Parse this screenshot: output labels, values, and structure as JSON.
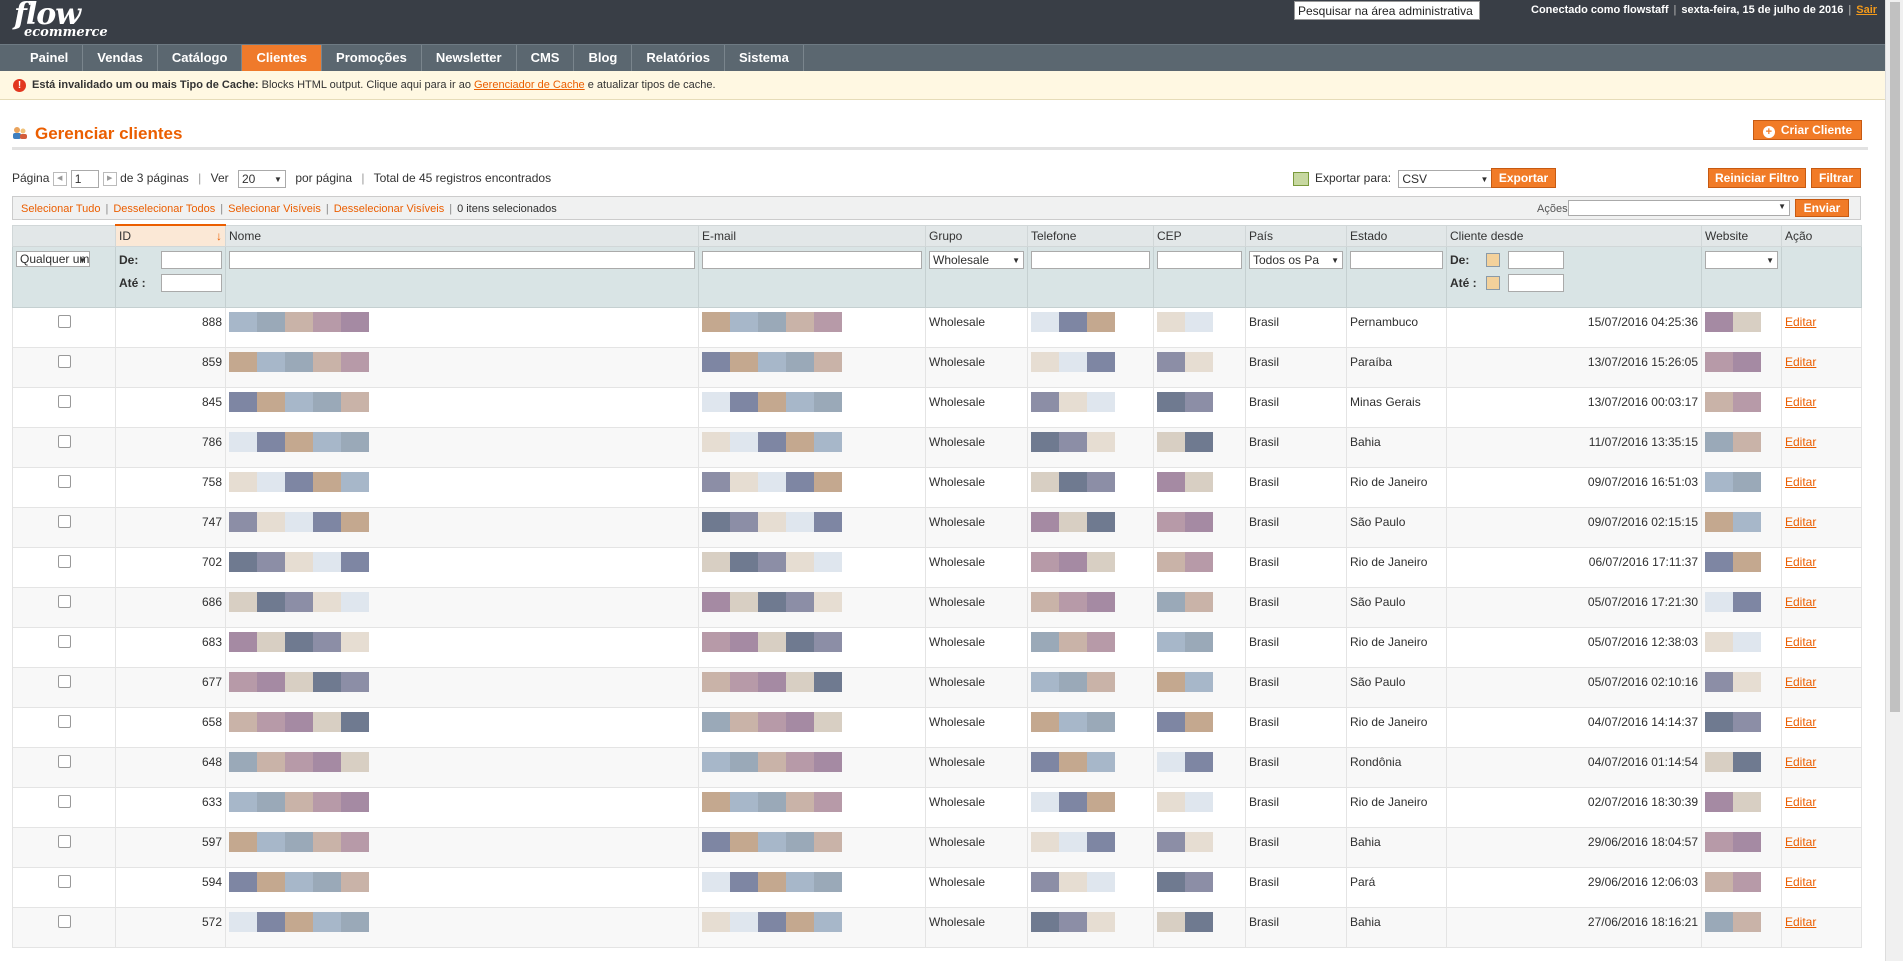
{
  "header": {
    "logo_line1": "flow",
    "logo_line2": "ecommerce",
    "search_placeholder": "Pesquisar na área administrativa",
    "connected_as": "Conectado como flowstaff",
    "date": "sexta-feira, 15 de julho de 2016",
    "logout": "Sair"
  },
  "nav": {
    "items": [
      "Painel",
      "Vendas",
      "Catálogo",
      "Clientes",
      "Promoções",
      "Newsletter",
      "CMS",
      "Blog",
      "Relatórios",
      "Sistema"
    ],
    "active": "Clientes"
  },
  "notice": {
    "prefix": "Está invalidado um ou mais Tipo de Cache:",
    "middle": " Blocks HTML output. Clique aqui para ir ao ",
    "link": "Gerenciador de Cache",
    "suffix": " e atualizar tipos de cache."
  },
  "page": {
    "title": "Gerenciar clientes",
    "create_button": "Criar Cliente"
  },
  "pager": {
    "page_label": "Página",
    "page_value": "1",
    "of_pages": "de 3 páginas",
    "view_label": "Ver",
    "per_page_value": "20",
    "per_page_label": "por página",
    "total": "Total de 45 registros encontrados"
  },
  "export": {
    "label": "Exportar para:",
    "format": "CSV",
    "button": "Exportar"
  },
  "filter_buttons": {
    "reset": "Reiniciar Filtro",
    "filter": "Filtrar"
  },
  "massaction": {
    "select_all": "Selecionar Tudo",
    "unselect_all": "Desselecionar Todos",
    "select_visible": "Selecionar Visíveis",
    "unselect_visible": "Desselecionar Visíveis",
    "count": "0 itens selecionados",
    "actions_label": "Ações",
    "submit": "Enviar"
  },
  "columns": [
    "",
    "ID",
    "Nome",
    "E-mail",
    "Grupo",
    "Telefone",
    "CEP",
    "País",
    "Estado",
    "Cliente desde",
    "Website",
    "Ação"
  ],
  "filters": {
    "any": "Qualquer um",
    "from": "De:",
    "to": "Até :",
    "group": "Wholesale",
    "country": "Todos os Pa"
  },
  "rows": [
    {
      "id": "888",
      "group": "Wholesale",
      "country": "Brasil",
      "state": "Pernambuco",
      "since": "15/07/2016 04:25:36",
      "action": "Editar"
    },
    {
      "id": "859",
      "group": "Wholesale",
      "country": "Brasil",
      "state": "Paraíba",
      "since": "13/07/2016 15:26:05",
      "action": "Editar"
    },
    {
      "id": "845",
      "group": "Wholesale",
      "country": "Brasil",
      "state": "Minas Gerais",
      "since": "13/07/2016 00:03:17",
      "action": "Editar"
    },
    {
      "id": "786",
      "group": "Wholesale",
      "country": "Brasil",
      "state": "Bahia",
      "since": "11/07/2016 13:35:15",
      "action": "Editar"
    },
    {
      "id": "758",
      "group": "Wholesale",
      "country": "Brasil",
      "state": "Rio de Janeiro",
      "since": "09/07/2016 16:51:03",
      "action": "Editar"
    },
    {
      "id": "747",
      "group": "Wholesale",
      "country": "Brasil",
      "state": "São Paulo",
      "since": "09/07/2016 02:15:15",
      "action": "Editar"
    },
    {
      "id": "702",
      "group": "Wholesale",
      "country": "Brasil",
      "state": "Rio de Janeiro",
      "since": "06/07/2016 17:11:37",
      "action": "Editar"
    },
    {
      "id": "686",
      "group": "Wholesale",
      "country": "Brasil",
      "state": "São Paulo",
      "since": "05/07/2016 17:21:30",
      "action": "Editar"
    },
    {
      "id": "683",
      "group": "Wholesale",
      "country": "Brasil",
      "state": "Rio de Janeiro",
      "since": "05/07/2016 12:38:03",
      "action": "Editar"
    },
    {
      "id": "677",
      "group": "Wholesale",
      "country": "Brasil",
      "state": "São Paulo",
      "since": "05/07/2016 02:10:16",
      "action": "Editar"
    },
    {
      "id": "658",
      "group": "Wholesale",
      "country": "Brasil",
      "state": "Rio de Janeiro",
      "since": "04/07/2016 14:14:37",
      "action": "Editar"
    },
    {
      "id": "648",
      "group": "Wholesale",
      "country": "Brasil",
      "state": "Rondônia",
      "since": "04/07/2016 01:14:54",
      "action": "Editar"
    },
    {
      "id": "633",
      "group": "Wholesale",
      "country": "Brasil",
      "state": "Rio de Janeiro",
      "since": "02/07/2016 18:30:39",
      "action": "Editar"
    },
    {
      "id": "597",
      "group": "Wholesale",
      "country": "Brasil",
      "state": "Bahia",
      "since": "29/06/2016 18:04:57",
      "action": "Editar"
    },
    {
      "id": "594",
      "group": "Wholesale",
      "country": "Brasil",
      "state": "Pará",
      "since": "29/06/2016 12:06:03",
      "action": "Editar"
    },
    {
      "id": "572",
      "group": "Wholesale",
      "country": "Brasil",
      "state": "Bahia",
      "since": "27/06/2016 18:16:21",
      "action": "Editar"
    }
  ],
  "colors": {
    "accent": "#eb5e00",
    "header_bg": "#393e46",
    "nav_bg": "#5b6770",
    "nav_active": "#ef7a2b",
    "button": "#f17b27"
  }
}
